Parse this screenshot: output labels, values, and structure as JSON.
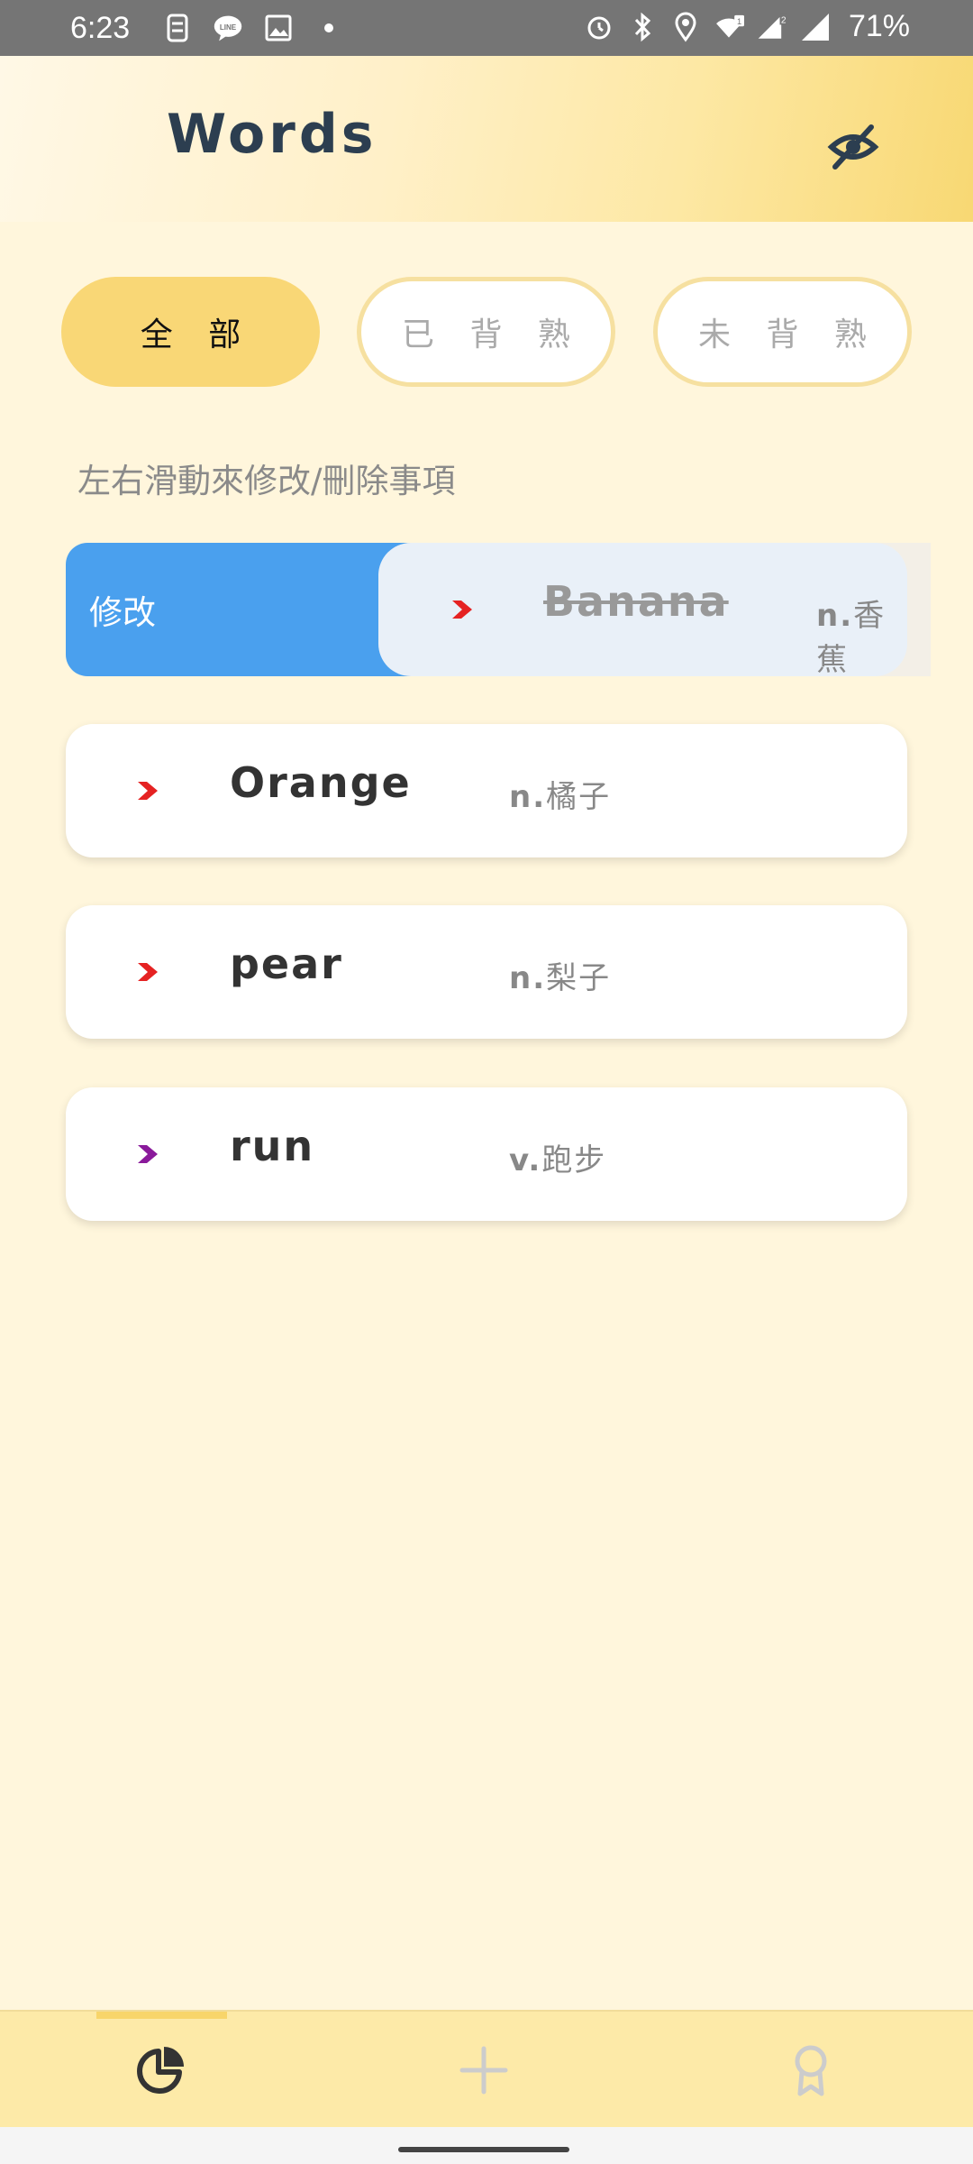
{
  "status_bar": {
    "time": "6:23",
    "battery": "71%",
    "left_icons": [
      "sim-icon",
      "line-icon",
      "gallery-icon",
      "dot-icon"
    ],
    "right_icons": [
      "alarm-icon",
      "bluetooth-icon",
      "location-icon",
      "wifi-icon",
      "signal-1-icon",
      "signal-2-icon"
    ],
    "sim_badges": [
      "1",
      "2"
    ]
  },
  "header": {
    "title": "Words",
    "visibility_icon": "eye-off-icon"
  },
  "filters": {
    "tabs": [
      {
        "label": "全 部",
        "active": true
      },
      {
        "label": "已 背 熟",
        "active": false
      },
      {
        "label": "未 背 熟",
        "active": false
      }
    ]
  },
  "hint": "左右滑動來修改/刪除事項",
  "swipe_action_label": "修改",
  "words": [
    {
      "word": "Banana",
      "pos": "n.",
      "meaning": "香蕉",
      "chevron_color": "#e52222",
      "memorized": true
    },
    {
      "word": "Orange",
      "pos": "n.",
      "meaning": "橘子",
      "chevron_color": "#e52222",
      "memorized": false
    },
    {
      "word": "pear",
      "pos": "n.",
      "meaning": "梨子",
      "chevron_color": "#e52222",
      "memorized": false
    },
    {
      "word": "run",
      "pos": "v.",
      "meaning": "跑步",
      "chevron_color": "#8a1a9b",
      "memorized": false
    }
  ],
  "bottom_nav": {
    "items": [
      "chart-pie-icon",
      "plus-icon",
      "award-icon"
    ],
    "active_index": 0
  },
  "colors": {
    "accent": "#f9d776",
    "background": "#fff6dc",
    "swipe_action": "#4aa0ee",
    "title": "#2c3e50"
  }
}
